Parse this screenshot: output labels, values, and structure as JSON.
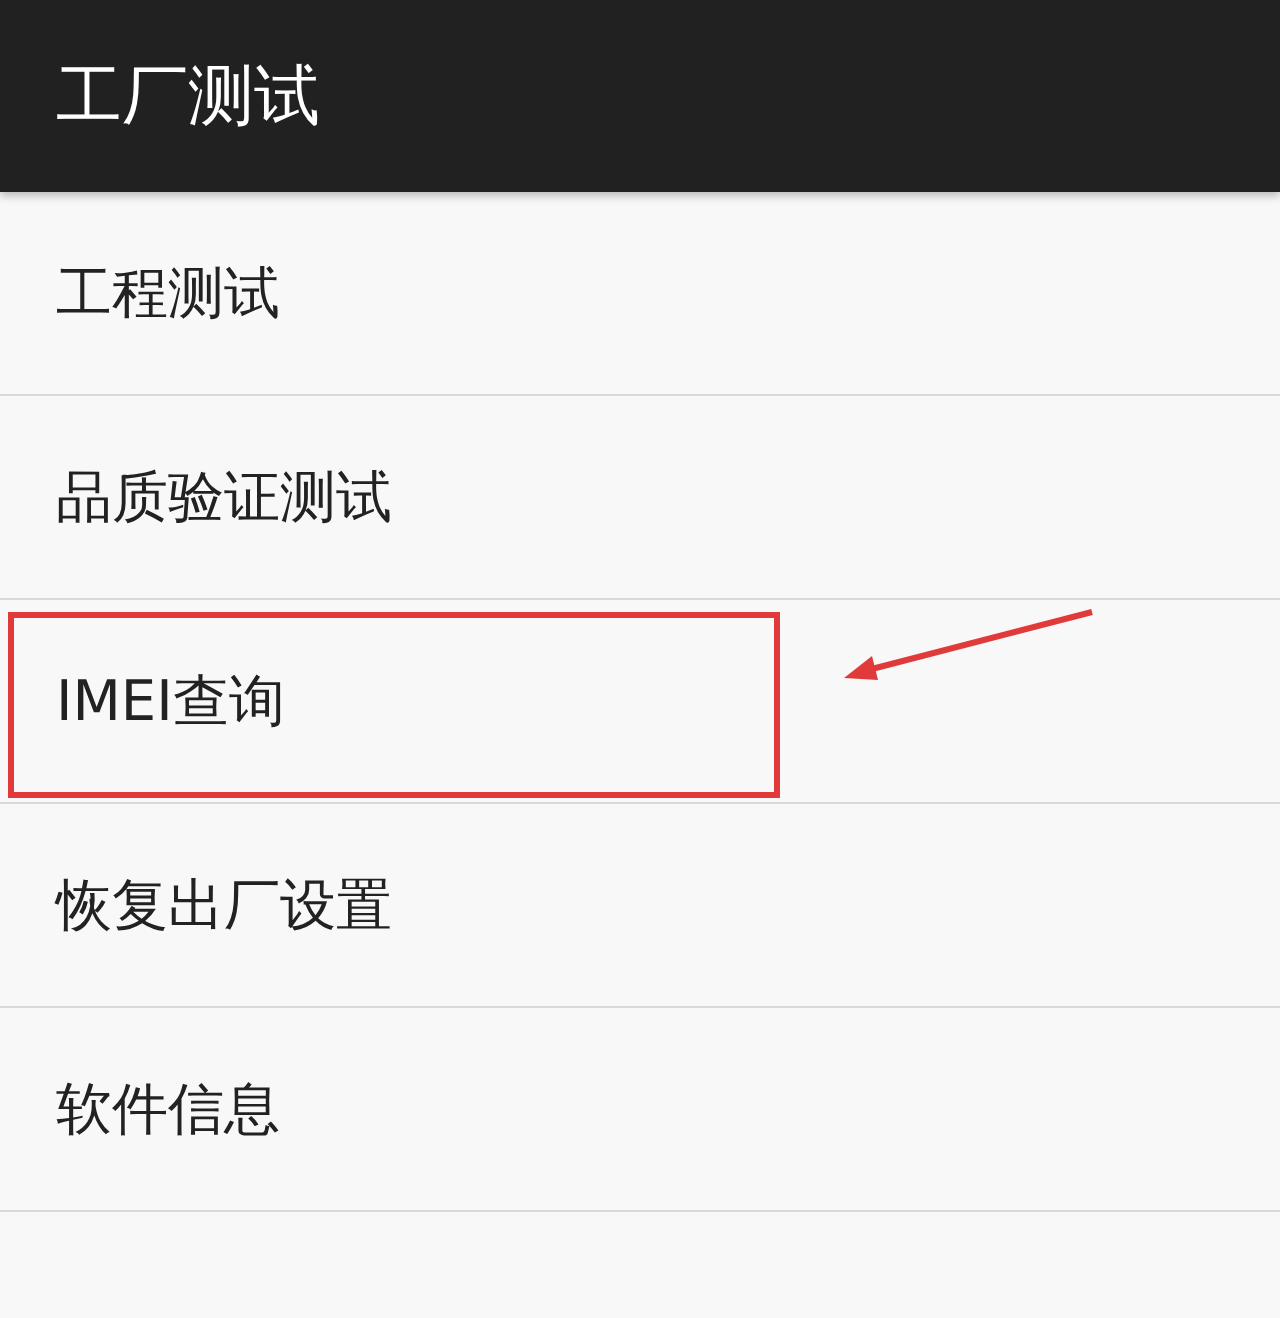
{
  "app_bar": {
    "title": "工厂测试"
  },
  "menu": [
    {
      "label": "工程测试",
      "highlighted": false
    },
    {
      "label": "品质验证测试",
      "highlighted": false
    },
    {
      "label": "IMEI查询",
      "highlighted": true
    },
    {
      "label": "恢复出厂设置",
      "highlighted": false
    },
    {
      "label": "软件信息",
      "highlighted": false
    }
  ]
}
